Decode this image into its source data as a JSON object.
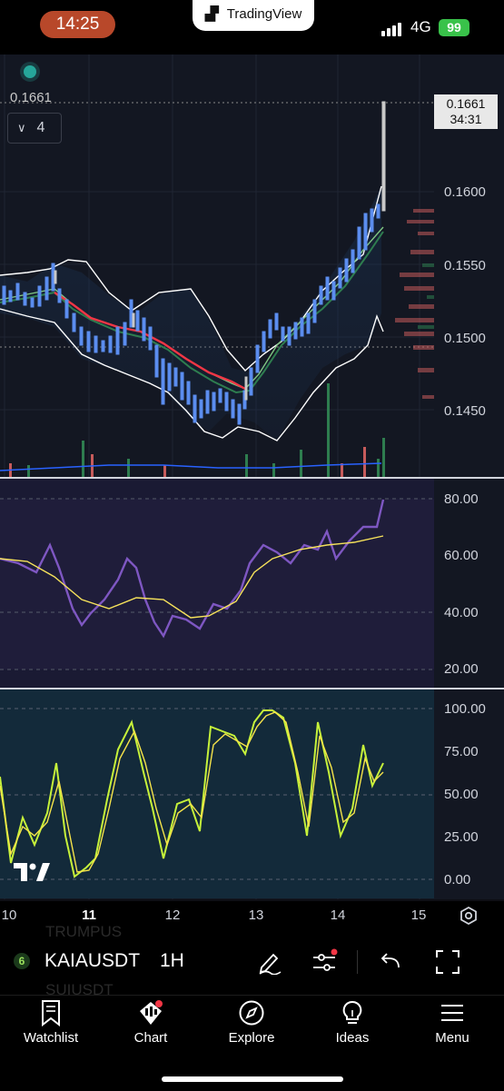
{
  "status_bar": {
    "time": "14:25",
    "app_pill": "TradingView",
    "network": "4G",
    "battery": "99"
  },
  "chart": {
    "symbol": "KAIAUSDT",
    "interval": "1H",
    "current_price": "0.1661",
    "countdown": "34:31",
    "top_price_label": "0.1661",
    "indicator_count": "4",
    "price_axis": [
      "0.1600",
      "0.1550",
      "0.1500",
      "0.1450"
    ],
    "rsi_axis": [
      "80.00",
      "60.00",
      "40.00",
      "20.00"
    ],
    "stoch_axis": [
      "100.00",
      "75.00",
      "50.00",
      "25.00",
      "0.00"
    ],
    "time_axis": [
      "10",
      "11",
      "12",
      "13",
      "14",
      "15"
    ],
    "watermark": "TV",
    "ghost_symbols": [
      "TRUMPUS",
      "SUIUSDT"
    ]
  },
  "colors": {
    "rsi_line": "#7e57c2",
    "rsi_ma": "#f7e35b",
    "stoch_k": "#c6f23a",
    "stoch_d": "#f5e34a",
    "accent_red": "#f23645",
    "accent_green": "#3fb950"
  },
  "tabs": [
    {
      "label": "Watchlist",
      "icon": "bookmark-icon"
    },
    {
      "label": "Chart",
      "icon": "chart-icon"
    },
    {
      "label": "Explore",
      "icon": "compass-icon"
    },
    {
      "label": "Ideas",
      "icon": "lightbulb-icon"
    },
    {
      "label": "Menu",
      "icon": "menu-icon"
    }
  ]
}
